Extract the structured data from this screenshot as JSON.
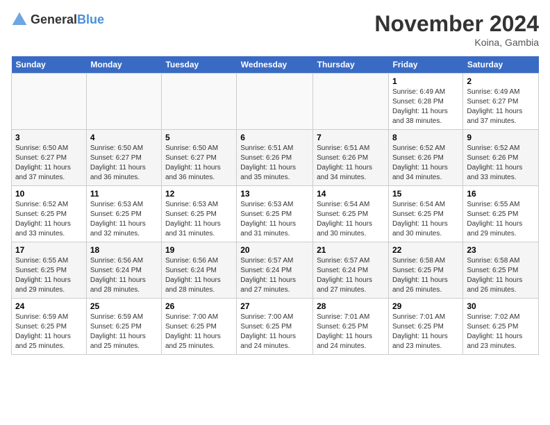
{
  "header": {
    "logo_general": "General",
    "logo_blue": "Blue",
    "month_title": "November 2024",
    "location": "Koina, Gambia"
  },
  "columns": [
    "Sunday",
    "Monday",
    "Tuesday",
    "Wednesday",
    "Thursday",
    "Friday",
    "Saturday"
  ],
  "weeks": [
    [
      {
        "day": "",
        "info": ""
      },
      {
        "day": "",
        "info": ""
      },
      {
        "day": "",
        "info": ""
      },
      {
        "day": "",
        "info": ""
      },
      {
        "day": "",
        "info": ""
      },
      {
        "day": "1",
        "info": "Sunrise: 6:49 AM\nSunset: 6:28 PM\nDaylight: 11 hours and 38 minutes."
      },
      {
        "day": "2",
        "info": "Sunrise: 6:49 AM\nSunset: 6:27 PM\nDaylight: 11 hours and 37 minutes."
      }
    ],
    [
      {
        "day": "3",
        "info": "Sunrise: 6:50 AM\nSunset: 6:27 PM\nDaylight: 11 hours and 37 minutes."
      },
      {
        "day": "4",
        "info": "Sunrise: 6:50 AM\nSunset: 6:27 PM\nDaylight: 11 hours and 36 minutes."
      },
      {
        "day": "5",
        "info": "Sunrise: 6:50 AM\nSunset: 6:27 PM\nDaylight: 11 hours and 36 minutes."
      },
      {
        "day": "6",
        "info": "Sunrise: 6:51 AM\nSunset: 6:26 PM\nDaylight: 11 hours and 35 minutes."
      },
      {
        "day": "7",
        "info": "Sunrise: 6:51 AM\nSunset: 6:26 PM\nDaylight: 11 hours and 34 minutes."
      },
      {
        "day": "8",
        "info": "Sunrise: 6:52 AM\nSunset: 6:26 PM\nDaylight: 11 hours and 34 minutes."
      },
      {
        "day": "9",
        "info": "Sunrise: 6:52 AM\nSunset: 6:26 PM\nDaylight: 11 hours and 33 minutes."
      }
    ],
    [
      {
        "day": "10",
        "info": "Sunrise: 6:52 AM\nSunset: 6:25 PM\nDaylight: 11 hours and 33 minutes."
      },
      {
        "day": "11",
        "info": "Sunrise: 6:53 AM\nSunset: 6:25 PM\nDaylight: 11 hours and 32 minutes."
      },
      {
        "day": "12",
        "info": "Sunrise: 6:53 AM\nSunset: 6:25 PM\nDaylight: 11 hours and 31 minutes."
      },
      {
        "day": "13",
        "info": "Sunrise: 6:53 AM\nSunset: 6:25 PM\nDaylight: 11 hours and 31 minutes."
      },
      {
        "day": "14",
        "info": "Sunrise: 6:54 AM\nSunset: 6:25 PM\nDaylight: 11 hours and 30 minutes."
      },
      {
        "day": "15",
        "info": "Sunrise: 6:54 AM\nSunset: 6:25 PM\nDaylight: 11 hours and 30 minutes."
      },
      {
        "day": "16",
        "info": "Sunrise: 6:55 AM\nSunset: 6:25 PM\nDaylight: 11 hours and 29 minutes."
      }
    ],
    [
      {
        "day": "17",
        "info": "Sunrise: 6:55 AM\nSunset: 6:25 PM\nDaylight: 11 hours and 29 minutes."
      },
      {
        "day": "18",
        "info": "Sunrise: 6:56 AM\nSunset: 6:24 PM\nDaylight: 11 hours and 28 minutes."
      },
      {
        "day": "19",
        "info": "Sunrise: 6:56 AM\nSunset: 6:24 PM\nDaylight: 11 hours and 28 minutes."
      },
      {
        "day": "20",
        "info": "Sunrise: 6:57 AM\nSunset: 6:24 PM\nDaylight: 11 hours and 27 minutes."
      },
      {
        "day": "21",
        "info": "Sunrise: 6:57 AM\nSunset: 6:24 PM\nDaylight: 11 hours and 27 minutes."
      },
      {
        "day": "22",
        "info": "Sunrise: 6:58 AM\nSunset: 6:25 PM\nDaylight: 11 hours and 26 minutes."
      },
      {
        "day": "23",
        "info": "Sunrise: 6:58 AM\nSunset: 6:25 PM\nDaylight: 11 hours and 26 minutes."
      }
    ],
    [
      {
        "day": "24",
        "info": "Sunrise: 6:59 AM\nSunset: 6:25 PM\nDaylight: 11 hours and 25 minutes."
      },
      {
        "day": "25",
        "info": "Sunrise: 6:59 AM\nSunset: 6:25 PM\nDaylight: 11 hours and 25 minutes."
      },
      {
        "day": "26",
        "info": "Sunrise: 7:00 AM\nSunset: 6:25 PM\nDaylight: 11 hours and 25 minutes."
      },
      {
        "day": "27",
        "info": "Sunrise: 7:00 AM\nSunset: 6:25 PM\nDaylight: 11 hours and 24 minutes."
      },
      {
        "day": "28",
        "info": "Sunrise: 7:01 AM\nSunset: 6:25 PM\nDaylight: 11 hours and 24 minutes."
      },
      {
        "day": "29",
        "info": "Sunrise: 7:01 AM\nSunset: 6:25 PM\nDaylight: 11 hours and 23 minutes."
      },
      {
        "day": "30",
        "info": "Sunrise: 7:02 AM\nSunset: 6:25 PM\nDaylight: 11 hours and 23 minutes."
      }
    ]
  ]
}
